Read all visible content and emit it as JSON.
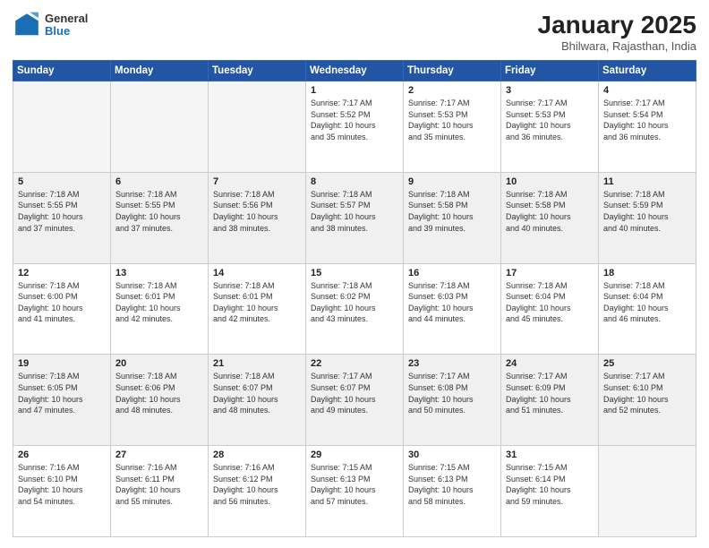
{
  "header": {
    "logo_general": "General",
    "logo_blue": "Blue",
    "title": "January 2025",
    "subtitle": "Bhilwara, Rajasthan, India"
  },
  "calendar": {
    "days_of_week": [
      "Sunday",
      "Monday",
      "Tuesday",
      "Wednesday",
      "Thursday",
      "Friday",
      "Saturday"
    ],
    "weeks": [
      [
        {
          "day": "",
          "info": "",
          "empty": true
        },
        {
          "day": "",
          "info": "",
          "empty": true
        },
        {
          "day": "",
          "info": "",
          "empty": true
        },
        {
          "day": "1",
          "info": "Sunrise: 7:17 AM\nSunset: 5:52 PM\nDaylight: 10 hours\nand 35 minutes."
        },
        {
          "day": "2",
          "info": "Sunrise: 7:17 AM\nSunset: 5:53 PM\nDaylight: 10 hours\nand 35 minutes."
        },
        {
          "day": "3",
          "info": "Sunrise: 7:17 AM\nSunset: 5:53 PM\nDaylight: 10 hours\nand 36 minutes."
        },
        {
          "day": "4",
          "info": "Sunrise: 7:17 AM\nSunset: 5:54 PM\nDaylight: 10 hours\nand 36 minutes."
        }
      ],
      [
        {
          "day": "5",
          "info": "Sunrise: 7:18 AM\nSunset: 5:55 PM\nDaylight: 10 hours\nand 37 minutes."
        },
        {
          "day": "6",
          "info": "Sunrise: 7:18 AM\nSunset: 5:55 PM\nDaylight: 10 hours\nand 37 minutes."
        },
        {
          "day": "7",
          "info": "Sunrise: 7:18 AM\nSunset: 5:56 PM\nDaylight: 10 hours\nand 38 minutes."
        },
        {
          "day": "8",
          "info": "Sunrise: 7:18 AM\nSunset: 5:57 PM\nDaylight: 10 hours\nand 38 minutes."
        },
        {
          "day": "9",
          "info": "Sunrise: 7:18 AM\nSunset: 5:58 PM\nDaylight: 10 hours\nand 39 minutes."
        },
        {
          "day": "10",
          "info": "Sunrise: 7:18 AM\nSunset: 5:58 PM\nDaylight: 10 hours\nand 40 minutes."
        },
        {
          "day": "11",
          "info": "Sunrise: 7:18 AM\nSunset: 5:59 PM\nDaylight: 10 hours\nand 40 minutes."
        }
      ],
      [
        {
          "day": "12",
          "info": "Sunrise: 7:18 AM\nSunset: 6:00 PM\nDaylight: 10 hours\nand 41 minutes."
        },
        {
          "day": "13",
          "info": "Sunrise: 7:18 AM\nSunset: 6:01 PM\nDaylight: 10 hours\nand 42 minutes."
        },
        {
          "day": "14",
          "info": "Sunrise: 7:18 AM\nSunset: 6:01 PM\nDaylight: 10 hours\nand 42 minutes."
        },
        {
          "day": "15",
          "info": "Sunrise: 7:18 AM\nSunset: 6:02 PM\nDaylight: 10 hours\nand 43 minutes."
        },
        {
          "day": "16",
          "info": "Sunrise: 7:18 AM\nSunset: 6:03 PM\nDaylight: 10 hours\nand 44 minutes."
        },
        {
          "day": "17",
          "info": "Sunrise: 7:18 AM\nSunset: 6:04 PM\nDaylight: 10 hours\nand 45 minutes."
        },
        {
          "day": "18",
          "info": "Sunrise: 7:18 AM\nSunset: 6:04 PM\nDaylight: 10 hours\nand 46 minutes."
        }
      ],
      [
        {
          "day": "19",
          "info": "Sunrise: 7:18 AM\nSunset: 6:05 PM\nDaylight: 10 hours\nand 47 minutes."
        },
        {
          "day": "20",
          "info": "Sunrise: 7:18 AM\nSunset: 6:06 PM\nDaylight: 10 hours\nand 48 minutes."
        },
        {
          "day": "21",
          "info": "Sunrise: 7:18 AM\nSunset: 6:07 PM\nDaylight: 10 hours\nand 48 minutes."
        },
        {
          "day": "22",
          "info": "Sunrise: 7:17 AM\nSunset: 6:07 PM\nDaylight: 10 hours\nand 49 minutes."
        },
        {
          "day": "23",
          "info": "Sunrise: 7:17 AM\nSunset: 6:08 PM\nDaylight: 10 hours\nand 50 minutes."
        },
        {
          "day": "24",
          "info": "Sunrise: 7:17 AM\nSunset: 6:09 PM\nDaylight: 10 hours\nand 51 minutes."
        },
        {
          "day": "25",
          "info": "Sunrise: 7:17 AM\nSunset: 6:10 PM\nDaylight: 10 hours\nand 52 minutes."
        }
      ],
      [
        {
          "day": "26",
          "info": "Sunrise: 7:16 AM\nSunset: 6:10 PM\nDaylight: 10 hours\nand 54 minutes."
        },
        {
          "day": "27",
          "info": "Sunrise: 7:16 AM\nSunset: 6:11 PM\nDaylight: 10 hours\nand 55 minutes."
        },
        {
          "day": "28",
          "info": "Sunrise: 7:16 AM\nSunset: 6:12 PM\nDaylight: 10 hours\nand 56 minutes."
        },
        {
          "day": "29",
          "info": "Sunrise: 7:15 AM\nSunset: 6:13 PM\nDaylight: 10 hours\nand 57 minutes."
        },
        {
          "day": "30",
          "info": "Sunrise: 7:15 AM\nSunset: 6:13 PM\nDaylight: 10 hours\nand 58 minutes."
        },
        {
          "day": "31",
          "info": "Sunrise: 7:15 AM\nSunset: 6:14 PM\nDaylight: 10 hours\nand 59 minutes."
        },
        {
          "day": "",
          "info": "",
          "empty": true
        }
      ]
    ]
  }
}
